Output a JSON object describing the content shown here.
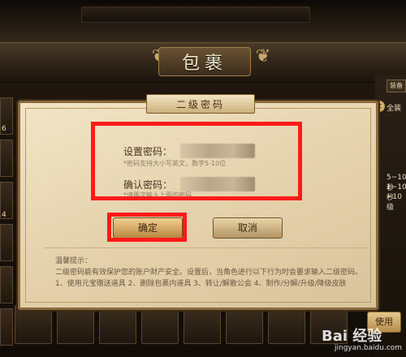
{
  "header": {
    "title": "包裹"
  },
  "left_column": {
    "badges": [
      "6",
      "4"
    ]
  },
  "right_panel": {
    "tab_label": "装备",
    "texts": [
      "全装",
      "5~10秒",
      "1~10秒",
      "~10级"
    ],
    "use_button": "使用"
  },
  "dialog": {
    "title": "二级密码",
    "set_password_label": "设置密码：",
    "set_password_hint": "*密码支持大小写英文，数字5-10位",
    "confirm_password_label": "确认密码：",
    "confirm_password_hint": "*请再次输入上面的密码",
    "confirm_button": "确定",
    "cancel_button": "取消",
    "notice": {
      "heading": "温馨提示：",
      "line1": "二级密码能有效保护您的账户财产安全。设置后，当角色进行以下行为时会要求输入二级密码。",
      "line2": "1、使用元宝赠送道具 2、删除包裹内道具 3、转让/解散公会 4、制作/分解/升级/降级皮肤"
    }
  },
  "watermark": {
    "brand": "Bai 经验",
    "url": "jingyan.baidu.com"
  },
  "colors": {
    "highlight": "#ff1a1a",
    "gold": "#b8873f",
    "parchment": "#e4d1ab"
  }
}
